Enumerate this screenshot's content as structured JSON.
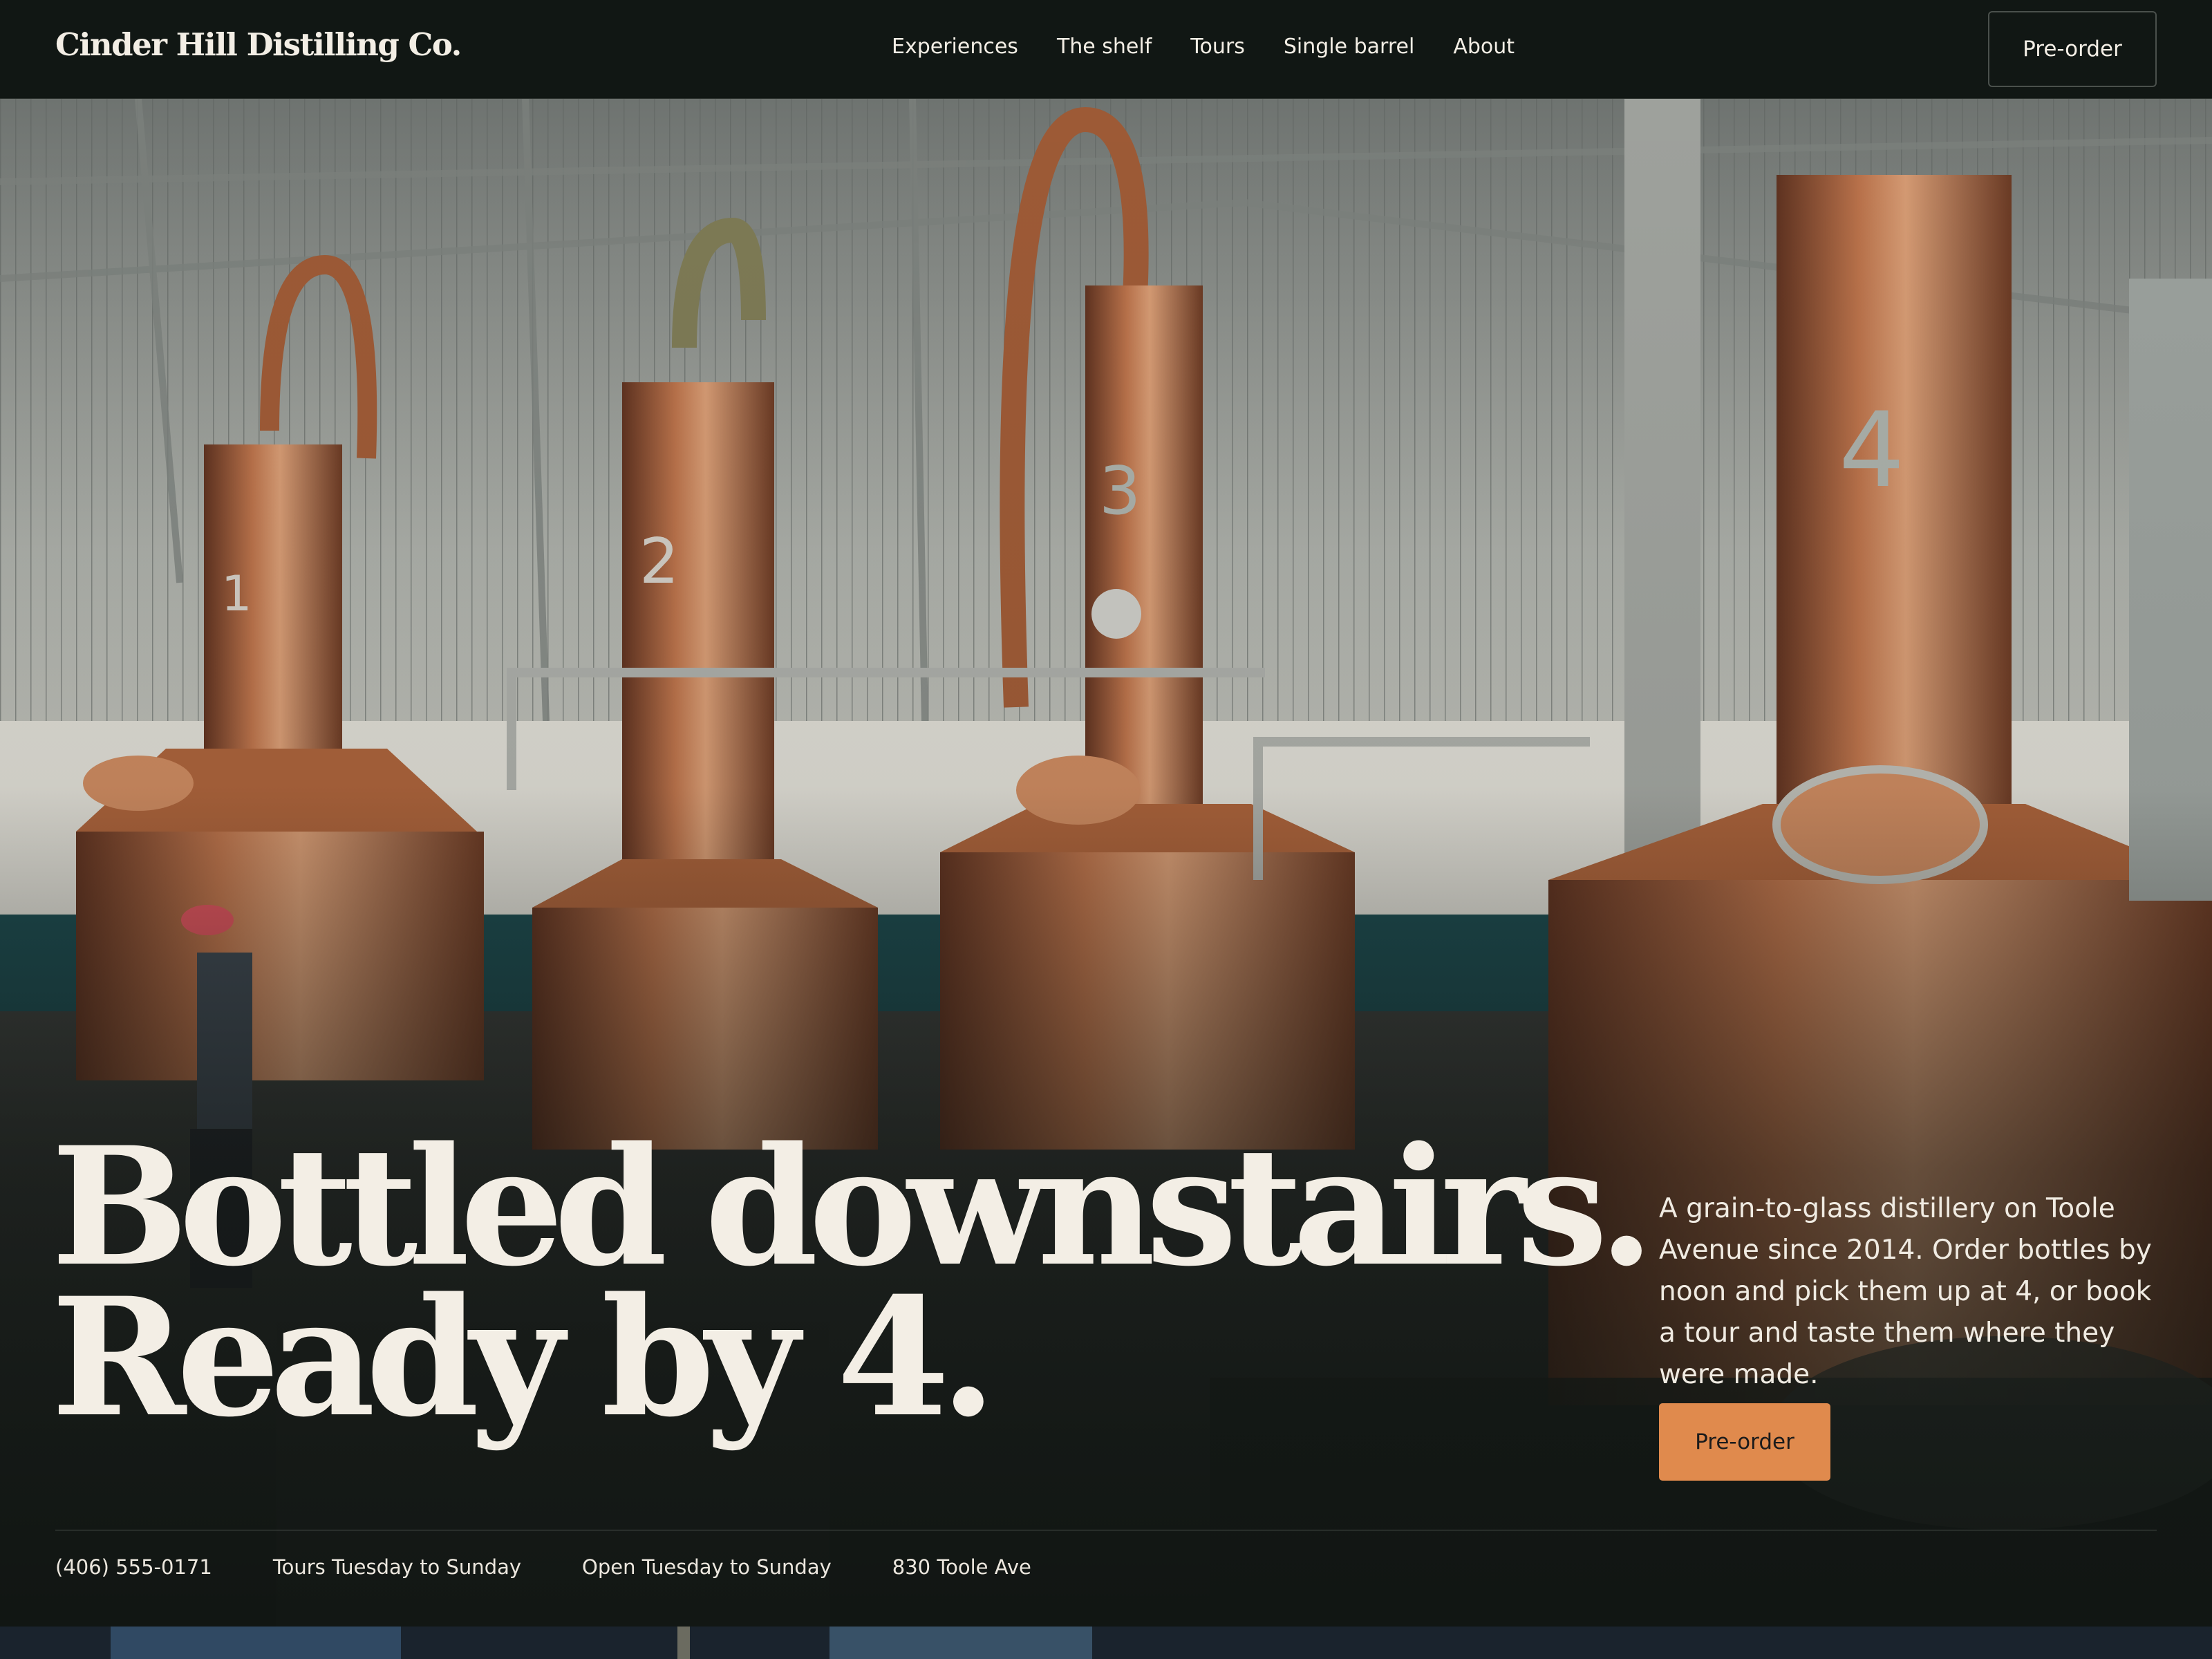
{
  "brand": {
    "name": "Cinder Hill Distilling Co."
  },
  "nav": {
    "links": [
      "Experiences",
      "The shelf",
      "Tours",
      "Single barrel",
      "About"
    ],
    "cta": "Pre-order"
  },
  "hero": {
    "headline_line1": "Bottled downstairs.",
    "headline_line2": "Ready by 4.",
    "intro": "A grain-to-glass distillery on Toole Avenue since 2014. Order bottles by noon and pick them up at 4, or book a tour and taste them where they were made.",
    "cta": "Pre-order",
    "still_numbers": [
      "1",
      "2",
      "3",
      "4"
    ]
  },
  "info_bar": {
    "items": [
      "(406) 555-0171",
      "Tours Tuesday to Sunday",
      "Open Tuesday to Sunday",
      "830 Toole Ave"
    ]
  },
  "colors": {
    "nav_bg": "#111714",
    "text_light": "#f3eee5",
    "accent": "#e08a4d",
    "copper": "#a8613a"
  }
}
